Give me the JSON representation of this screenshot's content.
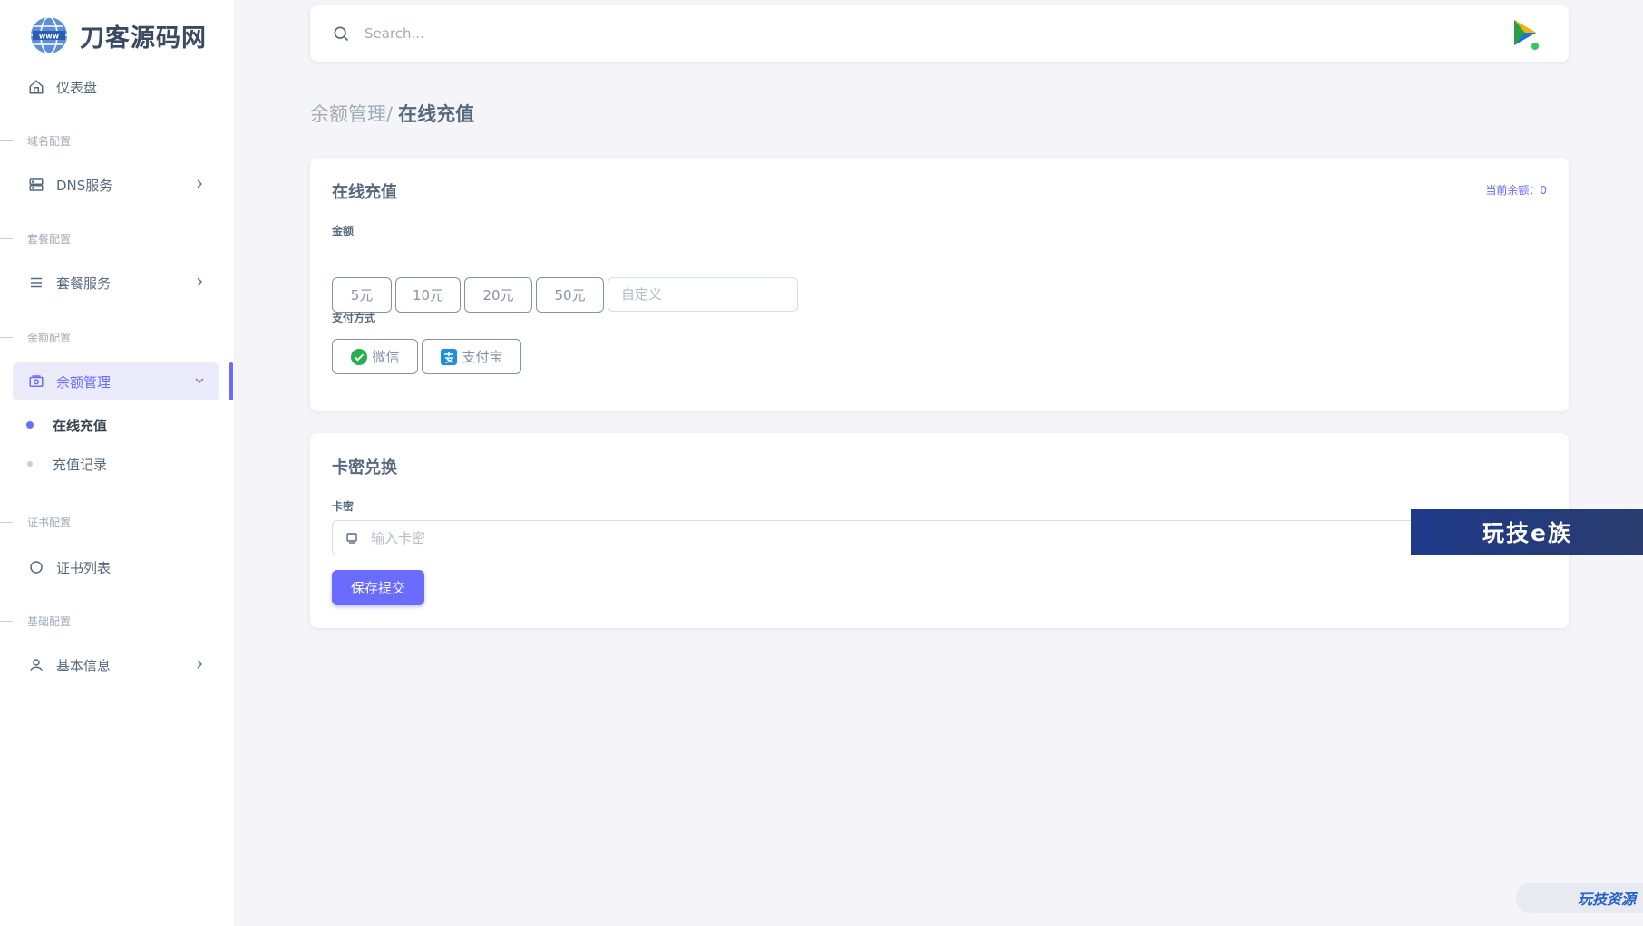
{
  "brand": {
    "name": "刀客源码网",
    "logo_icon": "globe-www-icon"
  },
  "sidebar": {
    "dashboard": {
      "label": "仪表盘",
      "icon": "home-icon"
    },
    "sections": {
      "domain": "域名配置",
      "package": "套餐配置",
      "balance": "余额配置",
      "cert": "证书配置",
      "basic": "基础配置"
    },
    "items": {
      "dns": {
        "label": "DNS服务",
        "icon": "server-icon"
      },
      "package": {
        "label": "套餐服务",
        "icon": "menu-icon"
      },
      "balance": {
        "label": "余额管理",
        "icon": "wallet-icon"
      },
      "cert": {
        "label": "证书列表",
        "icon": "circle-icon"
      },
      "basic": {
        "label": "基本信息",
        "icon": "user-icon"
      }
    },
    "sub_items": {
      "recharge": "在线充值",
      "records": "充值记录"
    }
  },
  "navbar": {
    "search_placeholder": "Search..."
  },
  "breadcrumb": {
    "parent": "余额管理/",
    "current": "在线充值"
  },
  "recharge_card": {
    "title": "在线充值",
    "balance": "当前余额：0",
    "amount_label": "金额",
    "amounts": [
      "5元",
      "10元",
      "20元",
      "50元"
    ],
    "custom_placeholder": "自定义",
    "payment_label": "支付方式",
    "wechat": "微信",
    "alipay": "支付宝"
  },
  "redeem_card": {
    "title": "卡密兑换",
    "field_label": "卡密",
    "input_placeholder": "输入卡密",
    "submit": "保存提交"
  },
  "watermarks": {
    "banner": "玩技e族",
    "corner": "玩技资源"
  },
  "colors": {
    "primary": "#696cff",
    "bg": "#f5f5f9",
    "text": "#566a7f"
  }
}
